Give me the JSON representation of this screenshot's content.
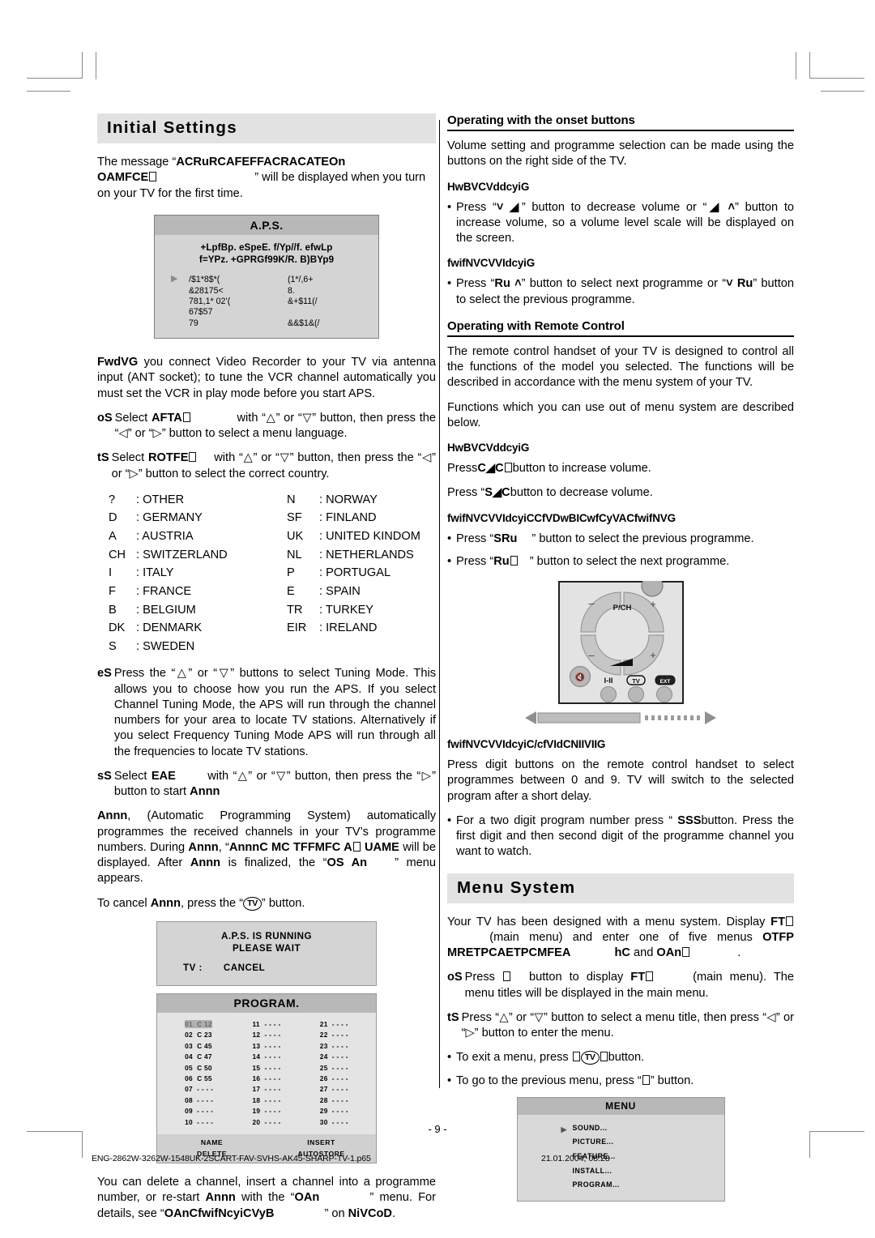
{
  "document": {
    "page_number": "- 9 -",
    "footer_left": "ENG-2862W-3262W-1548UK-2SCART-FAV-SVHS-AK45-SHARP-TV-1.p65",
    "footer_right": "21.01.2004, 08:28"
  },
  "left_column": {
    "heading": "Initial  Settings",
    "intro": {
      "before": "The message “",
      "garbled_1": "ACRuRCAFEFFACRACATEOn",
      "garbled_2": "OAMFCE",
      "after": "” will be displayed when you turn on your TV for the first time."
    },
    "aps_osd": {
      "title": "A.P.S.",
      "line1": "+LpfBp. eSpeE. f/Yp//f. efwLp",
      "line2": "f=YPz. +GPRGf99K/R. B)BYp9",
      "rows": [
        {
          "left": "/$1*8$*(",
          "right": "(1*/,6+"
        },
        {
          "left": "&28175<",
          "right": "8."
        },
        {
          "left": "781,1* 02’(",
          "right": "&+$11(/"
        },
        {
          "left": "67$57",
          "right": ""
        },
        {
          "left": "79",
          "right": "&&$1&(/",
          "indent": true
        }
      ]
    },
    "vcr_note": {
      "bold": "FwdVG",
      "text": " you connect Video Recorder to your TV via antenna input (ANT socket); to tune the VCR channel automatically you must set the VCR in play mode before you start APS."
    },
    "steps": [
      {
        "label": "oS",
        "parts": [
          "Select ",
          "AFTA",
          " with “△” or “▽” button, then press the “◁” or “▷” button to select a menu language."
        ]
      },
      {
        "label": "tS",
        "parts": [
          "Select ",
          "ROTFE",
          " with “△” or “▽” button, then press the “◁” or “▷” button to select the correct country."
        ]
      }
    ],
    "countries": [
      {
        "code": "?",
        "name": ": OTHER",
        "code2": "N",
        "name2": ": NORWAY"
      },
      {
        "code": "D",
        "name": ": GERMANY",
        "code2": "SF",
        "name2": ": FINLAND"
      },
      {
        "code": "A",
        "name": ": AUSTRIA",
        "code2": "UK",
        "name2": ": UNITED KINDOM"
      },
      {
        "code": "CH",
        "name": ": SWITZERLAND",
        "code2": "NL",
        "name2": ": NETHERLANDS"
      },
      {
        "code": "I",
        "name": ": ITALY",
        "code2": "P",
        "name2": ": PORTUGAL"
      },
      {
        "code": "F",
        "name": ": FRANCE",
        "code2": "E",
        "name2": ": SPAIN"
      },
      {
        "code": "B",
        "name": ": BELGIUM",
        "code2": "TR",
        "name2": ": TURKEY"
      },
      {
        "code": "DK",
        "name": ": DENMARK",
        "code2": "EIR",
        "name2": ": IRELAND"
      },
      {
        "code": "S",
        "name": ": SWEDEN",
        "code2": "",
        "name2": ""
      }
    ],
    "step3": {
      "label": "eS",
      "text": "Press the “△” or “▽” buttons to select Tuning Mode. This allows you to choose how you run the APS. If you select Channel Tuning Mode, the APS will run through the channel numbers for your area to locate TV stations. Alternatively if you select Frequency Tuning Mode APS will run through all the frequencies to locate TV stations."
    },
    "step4": {
      "label": "sS",
      "pre": "Select ",
      "bold1": "EAE",
      "mid": " with “△” or “▽” button, then press the “▷” button to start ",
      "bold2": "Annn"
    },
    "aps_para": {
      "b1": "Annn",
      "t1": ", (Automatic Programming System) automatically programmes the received channels in your TV’s programme numbers. During ",
      "b2": "Annn",
      "t2": ", “",
      "b3": "AnnnC MC TFFMFC A",
      "t3": "",
      "b4": "UAME",
      "t4": " will be displayed. After ",
      "b5": "Annn",
      "t5": " is finalized, the “",
      "b6": "OS An",
      "t6": "” menu appears."
    },
    "cancel_line": {
      "pre": "To cancel ",
      "bold": "Annn",
      "mid": ", press the “",
      "key": "TV",
      "post": "” button."
    },
    "running_box": {
      "line1": "A.P.S.  IS  RUNNING",
      "line2": "PLEASE  WAIT",
      "line3_label": "TV :",
      "line3_value": "CANCEL"
    },
    "program_box": {
      "title": "PROGRAM.",
      "column1": [
        {
          "num": "01",
          "val": "C 12",
          "highlight": true
        },
        {
          "num": "02",
          "val": "C 23"
        },
        {
          "num": "03",
          "val": "C 45"
        },
        {
          "num": "04",
          "val": "C 47"
        },
        {
          "num": "05",
          "val": "C 50"
        },
        {
          "num": "06",
          "val": "C 55"
        },
        {
          "num": "07",
          "val": "- - - -"
        },
        {
          "num": "08",
          "val": "- - - -"
        },
        {
          "num": "09",
          "val": "- - - -"
        },
        {
          "num": "10",
          "val": "- - - -"
        }
      ],
      "column2": [
        {
          "num": "11",
          "val": "- - - -"
        },
        {
          "num": "12",
          "val": "- - - -"
        },
        {
          "num": "13",
          "val": "- - - -"
        },
        {
          "num": "14",
          "val": "- - - -"
        },
        {
          "num": "15",
          "val": "- - - -"
        },
        {
          "num": "16",
          "val": "- - - -"
        },
        {
          "num": "17",
          "val": "- - - -"
        },
        {
          "num": "18",
          "val": "- - - -"
        },
        {
          "num": "19",
          "val": "- - - -"
        },
        {
          "num": "20",
          "val": "- - - -"
        }
      ],
      "column3": [
        {
          "num": "21",
          "val": "- - - -"
        },
        {
          "num": "22",
          "val": "- - - -"
        },
        {
          "num": "23",
          "val": "- - - -"
        },
        {
          "num": "24",
          "val": "- - - -"
        },
        {
          "num": "25",
          "val": "- - - -"
        },
        {
          "num": "26",
          "val": "- - - -"
        },
        {
          "num": "27",
          "val": "- - - -"
        },
        {
          "num": "28",
          "val": "- - - -"
        },
        {
          "num": "29",
          "val": "- - - -"
        },
        {
          "num": "30",
          "val": "- - - -"
        }
      ],
      "footer": {
        "name": "NAME",
        "insert": "INSERT",
        "delete": "DELETE",
        "autostore": "AUTOSTORE"
      }
    },
    "closing": {
      "t1": "You can delete a channel, insert a channel into a programme number, or re-start ",
      "b1": "Annn",
      "t2": " with the “",
      "b2": "OAn",
      "t3": "” menu. For details, see “",
      "b3": "OAnCfwifNcyiCVyB",
      "t4": "” on ",
      "b4": "NiVCoD",
      "t5": "."
    }
  },
  "right_column": {
    "onset": {
      "heading": "Operating with the onset buttons",
      "intro": "Volume setting and programme selection can be made using the buttons on the right side of the TV.",
      "volume_head": "HwBVCVddcyiG",
      "volume_bullet_pre": "Press “",
      "volume_bullet_b1": "˅ ◢",
      "volume_bullet_mid": "” button to decrease volume or “",
      "volume_bullet_b2": "◢ ˄",
      "volume_bullet_post": "” button to increase volume, so a volume level scale will be displayed on the screen.",
      "prog_head": "fwifNVCVVIdcyiG",
      "prog_bullet_pre": "Press “",
      "prog_bullet_b1": "Ru ˄",
      "prog_bullet_mid": "” button to select next programme or “",
      "prog_bullet_b2": "˅ Ru",
      "prog_bullet_post": "” button to select the previous programme."
    },
    "remote": {
      "heading": "Operating with Remote Control",
      "p1": "The remote control handset of your TV is designed to control all the functions of the model you selected. The functions will be described  in accordance with the menu system of your TV.",
      "p2": "Functions which you can use out of menu system are described below.",
      "volume_head": "HwBVCVddcyiG",
      "vol_up_pre": "Press",
      "vol_up_bold": "C◢C",
      "vol_up_post": "button to increase volume.",
      "vol_dn_pre": "Press “",
      "vol_dn_bold": "S◢C",
      "vol_dn_post": "button  to decrease volume.",
      "prog_head": "fwifNVCVVIdcyiCCfVDwBICwfCyVACfwifNVG",
      "bullets": [
        {
          "pre": "Press “",
          "bold": "SRu",
          "post": "” button to select the previous programme."
        },
        {
          "pre": "Press “",
          "bold": "Ru",
          "post": "” button to select the next programme."
        }
      ],
      "illustration": {
        "pch_label": "P/CH",
        "minus": "–",
        "plus": "+",
        "mute_icon": "mute-icon",
        "i_ii_label": "I-II",
        "tv_label": "TV",
        "ext_label": "EXT"
      }
    },
    "digits": {
      "heading": "fwifNVCVVIdcyiC/cfVIdCNIIVIIG",
      "p1": "Press digit buttons on the remote control handset to select programmes between 0 and 9. TV will switch to the selected program after a short delay.",
      "bullet_pre": "For a two digit program number press “ ",
      "bullet_bold": "SSS",
      "bullet_post": "button. Press the first digit and then second digit of the programme channel you want to watch."
    },
    "menu_system": {
      "heading": "Menu  System",
      "p1_a": "Your TV has been designed with a menu system. Display ",
      "p1_b1": "FT",
      "p1_b": " (main menu) and enter one of five menus ",
      "p1_b2": "OTFP MRETPCAETPCMFEA",
      "p1_c": "",
      "p1_b3": "hC",
      "p1_d": " and ",
      "p1_b4": "OAn",
      "p1_e": ".",
      "step1_label": "oS",
      "step1_pre": "Press ",
      "step1_mid": "button to display ",
      "step1_bold": "FT",
      "step1_post": "(main menu). The menu titles will be displayed in the main menu.",
      "step2_label": "tS",
      "step2_text": "Press “△” or “▽” button to select a menu title, then press “◁” or “▷” button to enter the menu.",
      "bullet1_pre": "To exit a menu, press ",
      "bullet1_key": "TV",
      "bullet1_post": "button.",
      "bullet2": "To go to the previous menu, press “",
      "bullet2_post": "” button.",
      "osd": {
        "title": "MENU",
        "items": [
          "SOUND...",
          "PICTURE...",
          "FEATURE...",
          "INSTALL...",
          "PROGRAM..."
        ]
      }
    }
  }
}
